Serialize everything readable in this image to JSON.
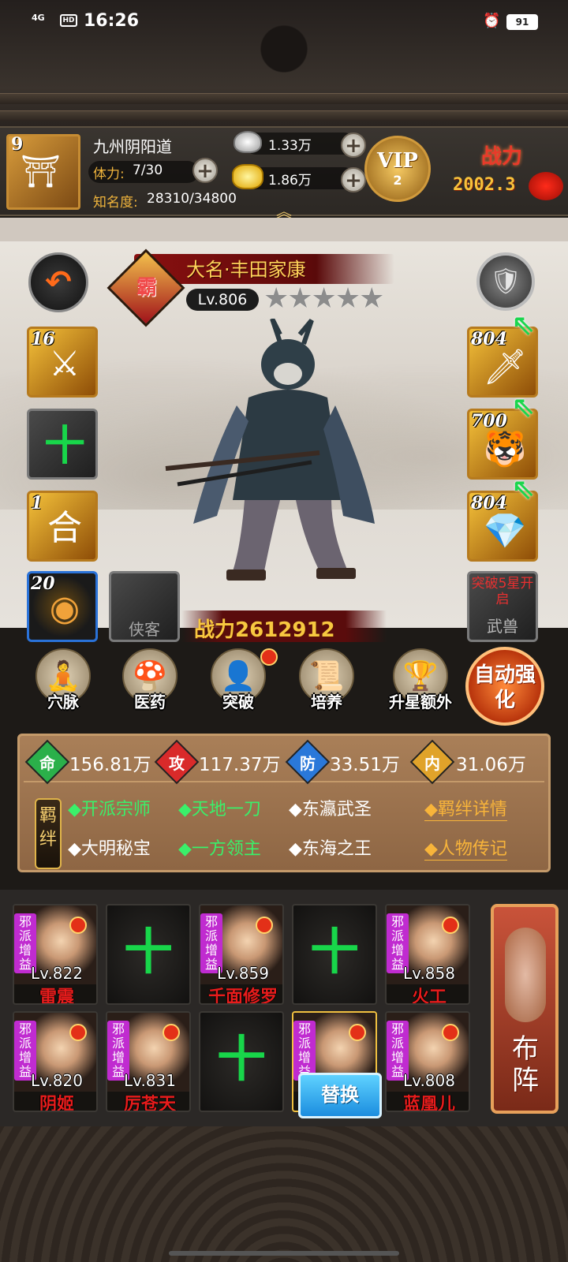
{
  "status_bar": {
    "network": "4G",
    "hd": "HD",
    "time": "16:26",
    "battery": "91"
  },
  "player": {
    "avatar_level": "9",
    "name": "九州阴阳道",
    "stamina_label": "体力:",
    "stamina_value": "7/30",
    "fame_label": "知名度:",
    "fame_value": "28310/34800",
    "silver": "1.33万",
    "gold": "1.86万",
    "vip_label": "VIP",
    "vip_level": "2",
    "power_label": "战力",
    "power_value": "2002.3"
  },
  "hero": {
    "faction_badge": "霸",
    "name": "大名·丰田家康",
    "level": "Lv.806",
    "stars": "★★★★★",
    "star_count": 5,
    "power": "战力2612912"
  },
  "left_slots": [
    {
      "num": "16",
      "glyph": "⚔"
    },
    {
      "num": "",
      "glyph": "十"
    },
    {
      "num": "1",
      "glyph": "合"
    },
    {
      "num": "20",
      "glyph": "◉"
    }
  ],
  "companion_slot_label": "侠客",
  "right_slots": [
    {
      "num": "804",
      "glyph": "🗡"
    },
    {
      "num": "700",
      "glyph": "🐯"
    },
    {
      "num": "804",
      "glyph": "💎"
    }
  ],
  "beast_slot": {
    "lock_text": "突破5星开启",
    "label": "武兽"
  },
  "actions": [
    {
      "label": "穴脉",
      "icon": "meridian-icon"
    },
    {
      "label": "医药",
      "icon": "herb-icon"
    },
    {
      "label": "突破",
      "icon": "breakthrough-icon"
    },
    {
      "label": "培养",
      "icon": "scroll-icon"
    },
    {
      "label": "升星额外",
      "icon": "star-up-icon"
    }
  ],
  "auto_button": "自动强化",
  "stats": [
    {
      "label": "命",
      "value": "156.81万",
      "color": "#2bb04a"
    },
    {
      "label": "攻",
      "value": "117.37万",
      "color": "#d92a2a"
    },
    {
      "label": "防",
      "value": "33.51万",
      "color": "#2a78d9"
    },
    {
      "label": "内",
      "value": "31.06万",
      "color": "#e0a32a"
    }
  ],
  "bonds_badge": "羁绊",
  "bonds": [
    {
      "text": "◆开派宗师",
      "active": true
    },
    {
      "text": "◆天地一刀",
      "active": true
    },
    {
      "text": "◆东瀛武圣",
      "active": false
    },
    {
      "text": "◆大明秘宝",
      "active": false
    },
    {
      "text": "◆一方领主",
      "active": true
    },
    {
      "text": "◆东海之王",
      "active": false
    }
  ],
  "bond_links": {
    "detail": "◆羁绊详情",
    "bio": "◆人物传记"
  },
  "roster": [
    {
      "level": "Lv.822",
      "name": "雷震",
      "evil": true,
      "empty": false
    },
    {
      "level": "",
      "name": "",
      "evil": false,
      "empty": true
    },
    {
      "level": "Lv.859",
      "name": "千面修罗",
      "evil": true,
      "empty": false
    },
    {
      "level": "",
      "name": "",
      "evil": false,
      "empty": true
    },
    {
      "level": "Lv.858",
      "name": "火工",
      "evil": true,
      "empty": false
    },
    {
      "level": "Lv.820",
      "name": "阴姬",
      "evil": true,
      "empty": false
    },
    {
      "level": "Lv.831",
      "name": "厉苍天",
      "evil": true,
      "empty": false
    },
    {
      "level": "",
      "name": "",
      "evil": false,
      "empty": true
    },
    {
      "level": "",
      "name": "",
      "evil": true,
      "empty": false,
      "selected": true
    },
    {
      "level": "Lv.808",
      "name": "蓝凰儿",
      "evil": true,
      "empty": false
    }
  ],
  "evil_tag": "邪派增益",
  "replace_button": "替换",
  "deploy_button": "布阵"
}
